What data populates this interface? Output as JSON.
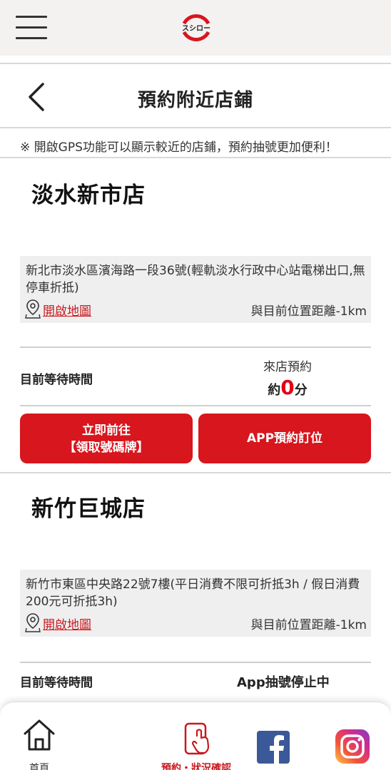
{
  "header": {
    "logo_text": "スシロー",
    "menu_icon": "hamburger-menu-icon"
  },
  "title_bar": {
    "back_icon": "chevron-left-icon",
    "title": "預約附近店鋪"
  },
  "gps_note": "※ 開啟GPS功能可以顯示較近的店鋪，預約抽號更加便利！",
  "stores": [
    {
      "name": "淡水新市店",
      "address": "新北市淡水區濱海路一段36號(輕軌淡水行政中心站電梯出口,無停車折抵)",
      "map_link": "開啟地圖",
      "distance": "與目前位置距離-1km",
      "wait_label": "目前等待時間",
      "wait_type": "來店預約",
      "wait_prefix": "約",
      "wait_minutes": "0",
      "wait_suffix": "分",
      "btn_go_line1": "立即前往",
      "btn_go_line2": "【領取號碼牌】",
      "btn_app": "APP預約訂位"
    },
    {
      "name": "新竹巨城店",
      "address": "新竹市東區中央路22號7樓(平日消費不限可折抵3h / 假日消費200元可折抵3h)",
      "map_link": "開啟地圖",
      "distance": "與目前位置距離-1km",
      "wait_label": "目前等待時間",
      "app_status": "App抽號停止中"
    }
  ],
  "bottom_nav": {
    "home_label": "首頁",
    "reserve_label": "預約・狀況確認",
    "facebook_icon": "facebook-icon",
    "instagram_icon": "instagram-icon"
  },
  "colors": {
    "brand_red": "#d7161e",
    "highlight_red": "#e50012",
    "header_bg": "#f4f1f1"
  }
}
